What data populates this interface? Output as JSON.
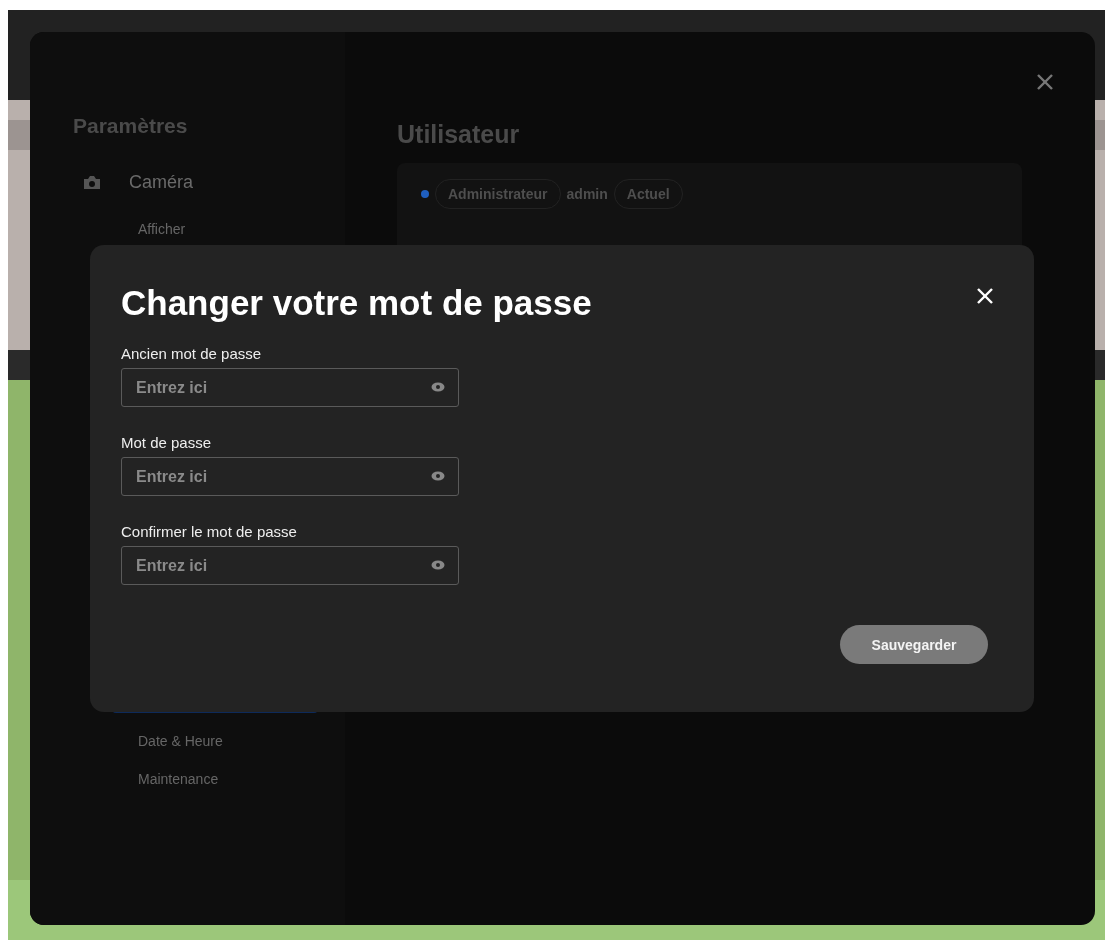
{
  "settings": {
    "title": "Paramètres",
    "sidebar": [
      {
        "label": "Caméra",
        "kind": "section"
      },
      {
        "label": "Afficher",
        "kind": "item"
      },
      {
        "kind": "highlight"
      },
      {
        "label": "Date & Heure",
        "kind": "item"
      },
      {
        "label": "Maintenance",
        "kind": "item"
      }
    ],
    "page_title": "Utilisateur",
    "user": {
      "role": "Administrateur",
      "name": "admin",
      "tag": "Actuel"
    }
  },
  "dialog": {
    "title": "Changer votre mot de passe",
    "fields": [
      {
        "label": "Ancien mot de passe",
        "placeholder": "Entrez ici"
      },
      {
        "label": "Mot de passe",
        "placeholder": "Entrez ici"
      },
      {
        "label": "Confirmer le mot de passe",
        "placeholder": "Entrez ici"
      }
    ],
    "save": "Sauvegarder"
  }
}
